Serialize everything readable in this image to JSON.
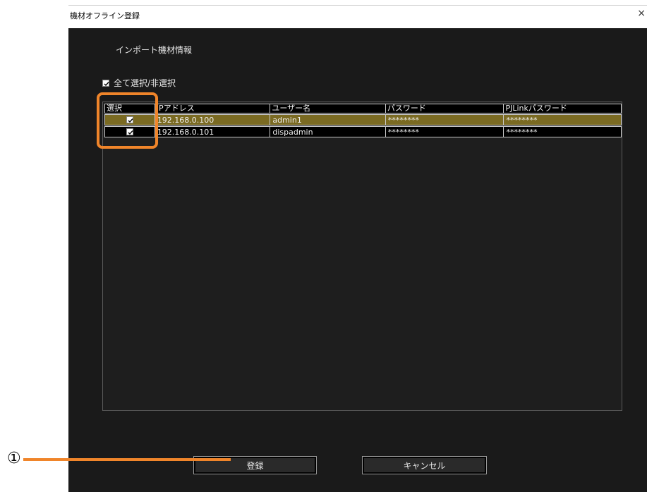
{
  "window": {
    "title": "機材オフライン登録",
    "close_glyph": "×"
  },
  "section_title": "インポート機材情報",
  "select_all": {
    "label": "全て選択/非選択",
    "checked": true
  },
  "table": {
    "headers": [
      "選択",
      "IPアドレス",
      "ユーザー名",
      "パスワード",
      "PJLinkパスワード"
    ],
    "rows": [
      {
        "checked": true,
        "ip": "192.168.0.100",
        "user": "admin1",
        "password": "********",
        "pjlink": "********",
        "highlighted": true
      },
      {
        "checked": true,
        "ip": "192.168.0.101",
        "user": "dispadmin",
        "password": "********",
        "pjlink": "********",
        "highlighted": false
      }
    ]
  },
  "buttons": {
    "register": "登録",
    "cancel": "キャンセル"
  },
  "callout": {
    "number": "①"
  },
  "colors": {
    "accent_orange": "#f0852a",
    "selected_row": "#7a6a22",
    "background": "#1a1a1a"
  }
}
